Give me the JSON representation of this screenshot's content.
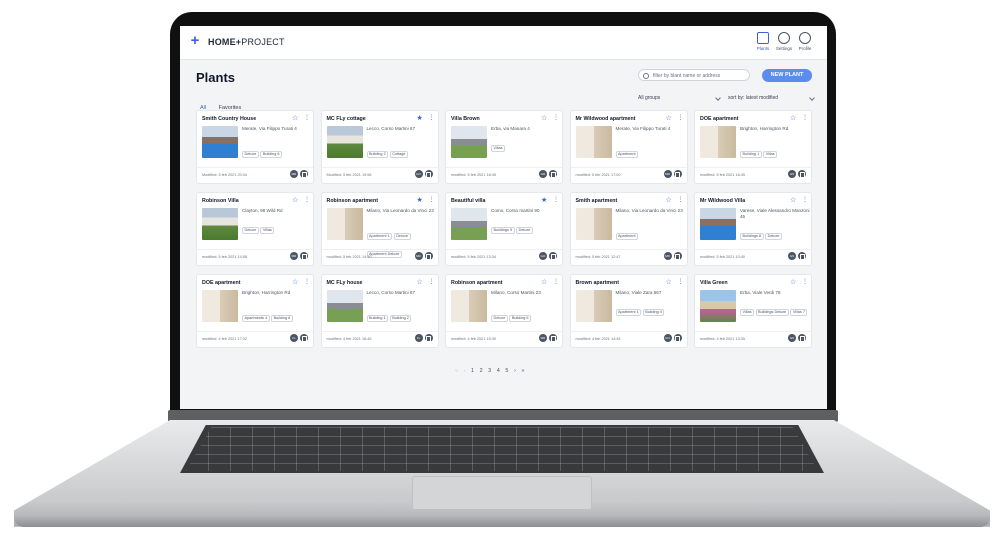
{
  "app": {
    "brand_bold": "HOME+",
    "brand_light": "PROJECT"
  },
  "nav": [
    {
      "label": "Plants",
      "icon": "home-icon"
    },
    {
      "label": "Settings",
      "icon": "gear-icon"
    },
    {
      "label": "Profile",
      "icon": "user-icon"
    }
  ],
  "page": {
    "title": "Plants",
    "search_placeholder": "filter by blant name or address",
    "new_button": "NEW PLANT",
    "tabs": [
      "All",
      "Favorites"
    ],
    "group_filter": "All groups",
    "sort": "sort by: latest modified"
  },
  "cards": [
    {
      "name": "Smith Country House",
      "star": "☆",
      "address": "Merate, Via Filippo Turati 4",
      "tags": [
        "Deluxe",
        "Building 6"
      ],
      "modified": "Modified: 5 feb 2021 20:34",
      "avatar": "MR",
      "thumb": "pool"
    },
    {
      "name": "MC FLy cottage",
      "star": "★",
      "address": "Lecco, Corso Martini 67",
      "tags": [
        "Building 2",
        "Cottage"
      ],
      "modified": "Modified: 5 feb 2021 19:56",
      "avatar": "GO",
      "thumb": "green"
    },
    {
      "name": "Villa Brown",
      "star": "☆",
      "address": "Erba, via Manara 4",
      "tags": [
        "Villas"
      ],
      "modified": "modified: 5 feb 2021 18:45",
      "avatar": "GR",
      "thumb": "house"
    },
    {
      "name": "Mr Wildwood apartment",
      "star": "☆",
      "address": "Merate, Via Filippo Turati 4",
      "tags": [
        "Apartment"
      ],
      "modified": "modified: 5 feb 2021 17:00",
      "avatar": "MR",
      "thumb": "room"
    },
    {
      "name": "DOE apartment",
      "star": "☆",
      "address": "Brighton,  Harrington Rd",
      "tags": [
        "Building 1",
        "Villas"
      ],
      "modified": "modified: 5 feb 2021 16:45",
      "avatar": "GS",
      "thumb": "room"
    },
    {
      "name": "Robinson Villa",
      "star": "☆",
      "address": "Clayton, 98 Wild Rd",
      "tags": [
        "Deluxe",
        "Villas"
      ],
      "modified": "modified: 5 feb 2021 14:58",
      "avatar": "MR",
      "thumb": "green"
    },
    {
      "name": "Robinson apartment",
      "star": "★",
      "address": "Milano, Via Leonardo da Vinci 23",
      "tags": [
        "Apartment 1",
        "Deluxe",
        "Apartment Deluxe"
      ],
      "modified": "modified: 5 feb 2021 14:30",
      "avatar": "MR",
      "thumb": "room"
    },
    {
      "name": "Beautiful villa",
      "star": "★",
      "address": "Como, Corso martini 90",
      "tags": [
        "Buildings 9",
        "Deluxe"
      ],
      "modified": "modified: 5 feb 2021 13:34",
      "avatar": "GO",
      "thumb": "house"
    },
    {
      "name": "Smith apartment",
      "star": "☆",
      "address": "Milano, Via Leonardo da Vinci 23",
      "tags": [
        "Apartment"
      ],
      "modified": "modified: 5 feb 2021 12:47",
      "avatar": "MR",
      "thumb": "room"
    },
    {
      "name": "Mr Wildwood Villa",
      "star": "☆",
      "address": "Varese, Viale Alessandro Manzoni 45",
      "tags": [
        "Buildings 8",
        "Deluxe"
      ],
      "modified": "modified: 5 feb 2021 10:40",
      "avatar": "GS",
      "thumb": "pool"
    },
    {
      "name": "DOE apartment",
      "star": "☆",
      "address": "Brighton,  Harrington Rd",
      "tags": [
        "Apartments 4",
        "Building 6"
      ],
      "modified": "modified: 4 feb 2021 17:32",
      "avatar": "FL",
      "thumb": "room"
    },
    {
      "name": "MC FLy house",
      "star": "☆",
      "address": "Lecco, Corso Martini 67",
      "tags": [
        "Building 1",
        "Building 2"
      ],
      "modified": "modified: 4 feb 2021 16:45",
      "avatar": "FL",
      "thumb": "house"
    },
    {
      "name": "Robinson apartment",
      "star": "☆",
      "address": "Milano, Corso Martini 23",
      "tags": [
        "Deluxe",
        "Building 6"
      ],
      "modified": "modified: 4 feb 2021 15:30",
      "avatar": "MR",
      "thumb": "room"
    },
    {
      "name": "Brown apartment",
      "star": "☆",
      "address": "Milano, Viale Zara 567",
      "tags": [
        "Apartment 1",
        "Building 4"
      ],
      "modified": "modified: 4 feb 2021 14:45",
      "avatar": "GO",
      "thumb": "room"
    },
    {
      "name": "Villa Green",
      "star": "☆",
      "address": "Erba, Viale Verdi 78",
      "tags": [
        "Villas",
        "Buildings Deluxe",
        "Villas 7"
      ],
      "modified": "modified: 4 feb 2021 13:35",
      "avatar": "GS",
      "thumb": "flowers"
    }
  ],
  "pager": {
    "prev_first": "«",
    "prev": "‹",
    "pages": [
      "1",
      "2",
      "3",
      "4",
      "5"
    ],
    "next": "›",
    "next_last": "»"
  }
}
